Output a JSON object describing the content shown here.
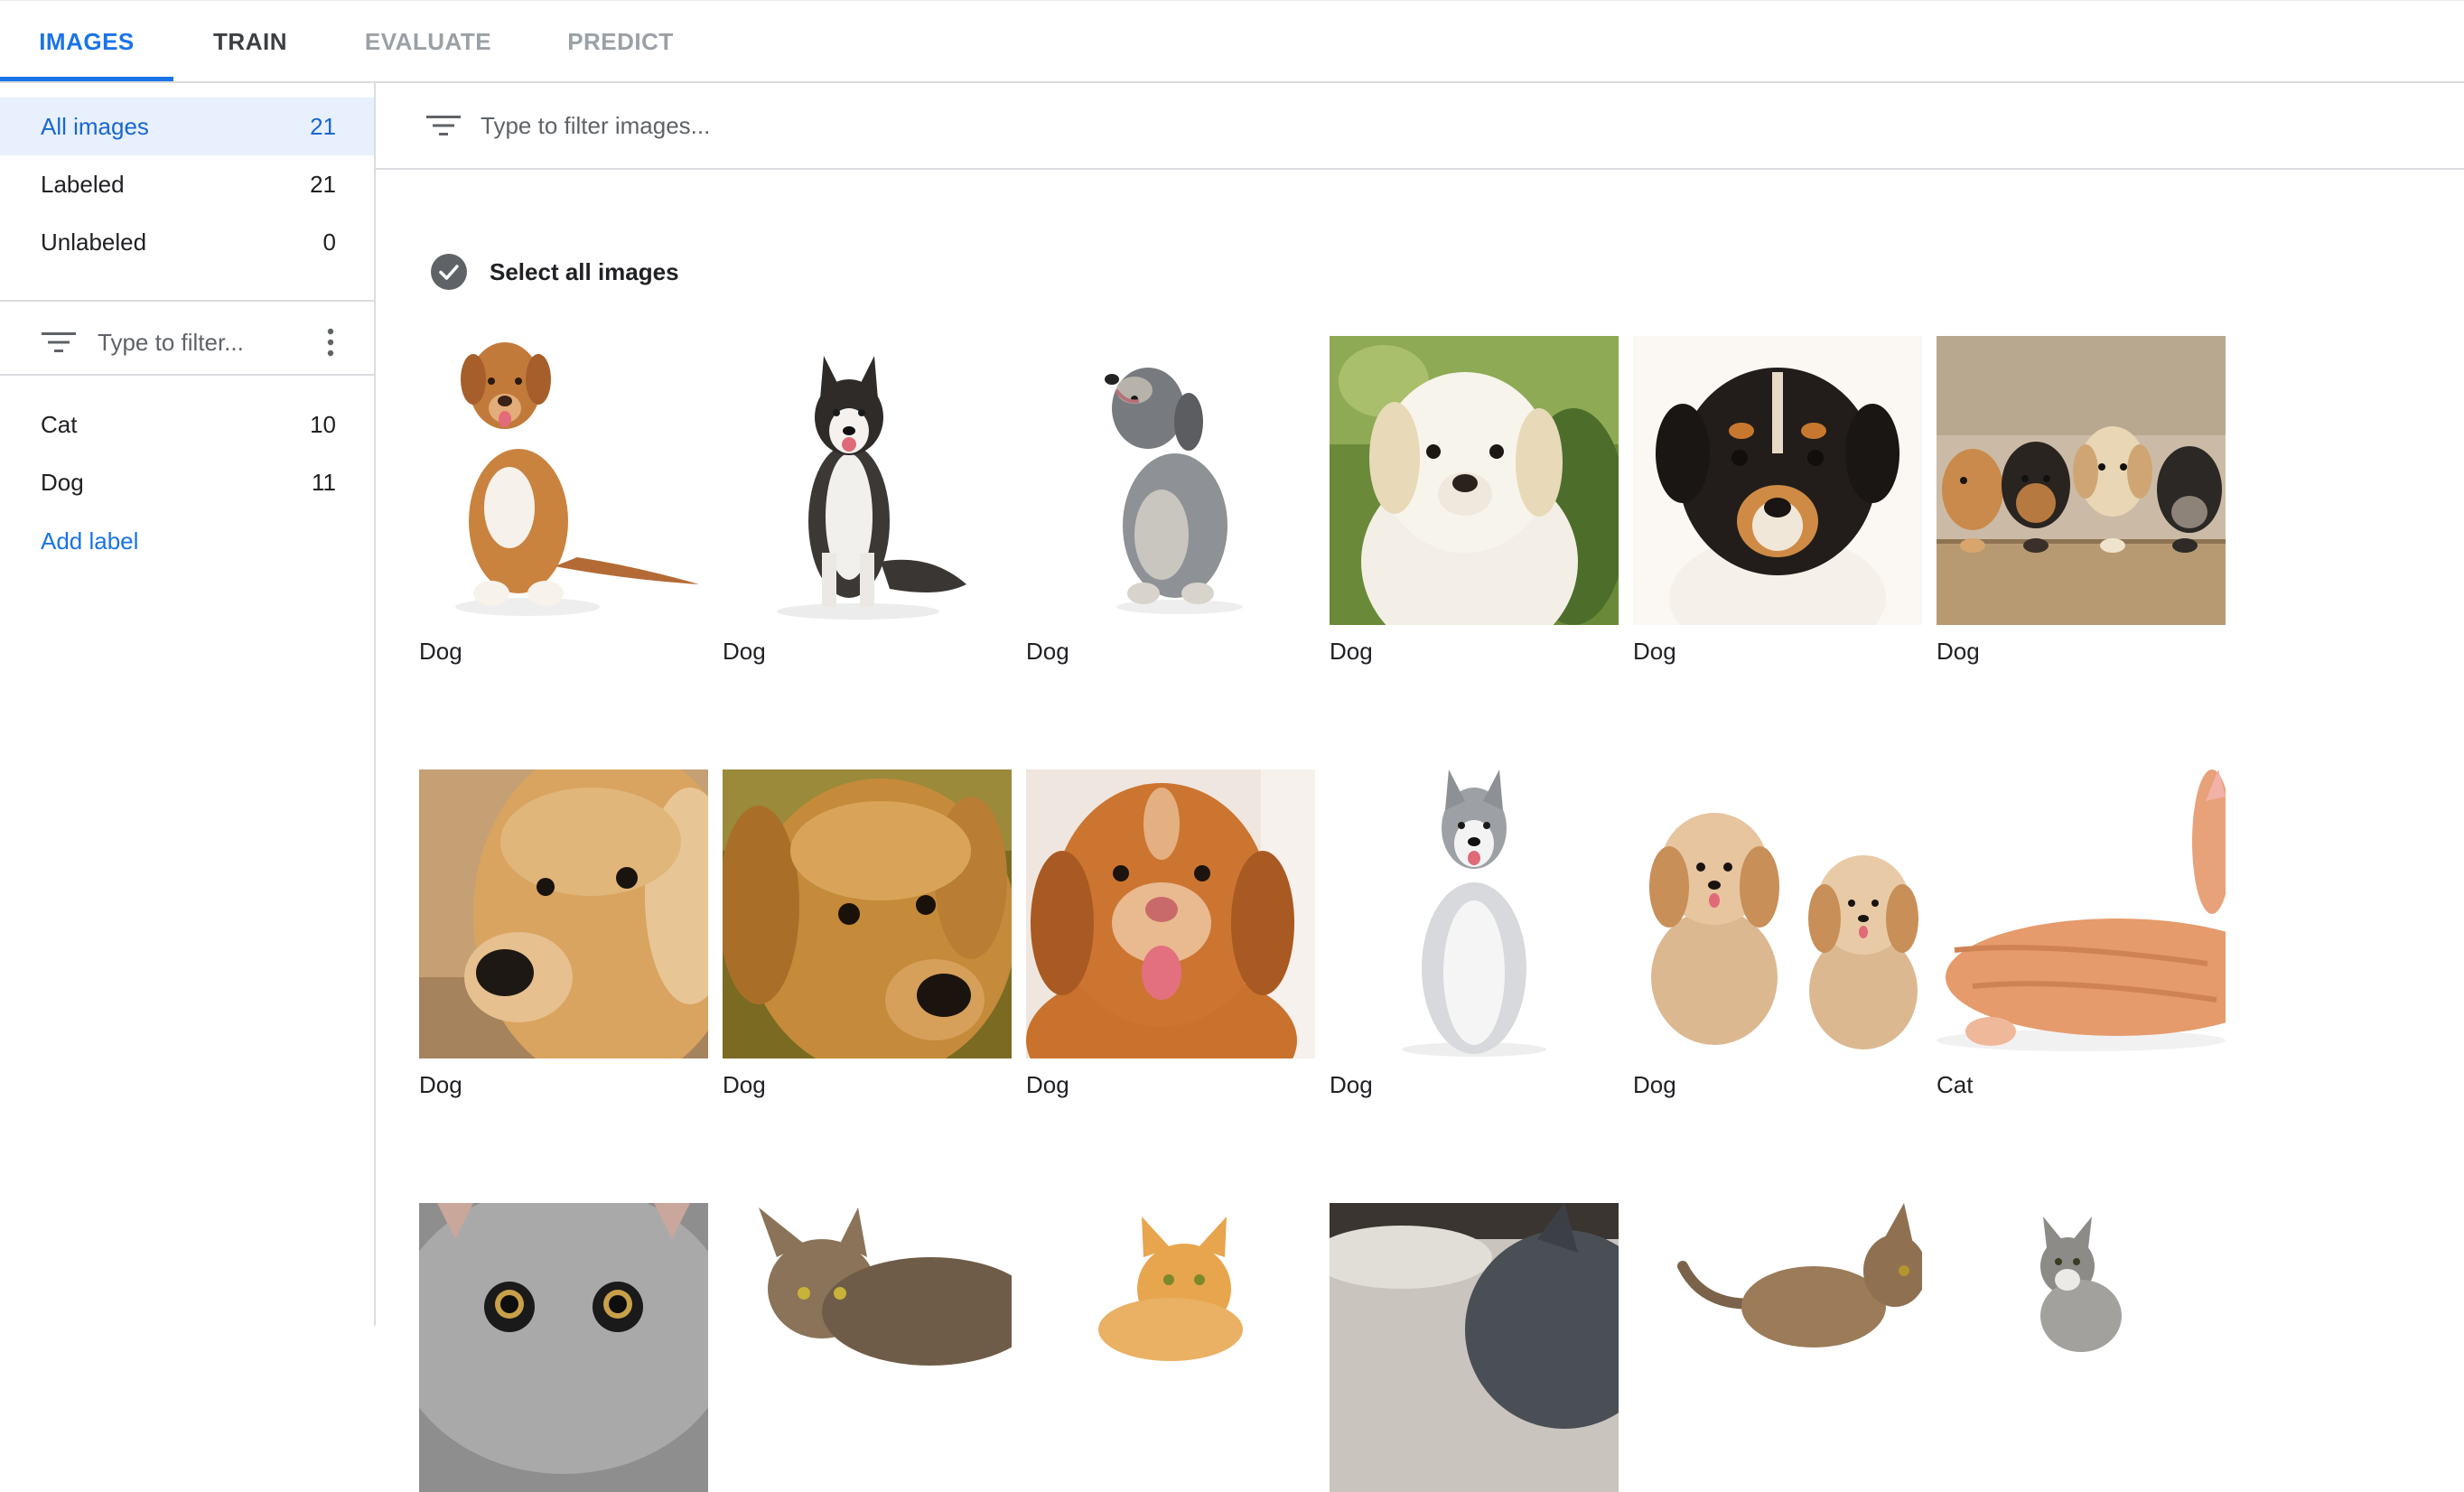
{
  "tabs": [
    {
      "label": "IMAGES",
      "state": "active"
    },
    {
      "label": "TRAIN",
      "state": "enabled"
    },
    {
      "label": "EVALUATE",
      "state": "disabled"
    },
    {
      "label": "PREDICT",
      "state": "disabled"
    }
  ],
  "sidebar": {
    "filters": [
      {
        "label": "All images",
        "count": "21",
        "selected": true
      },
      {
        "label": "Labeled",
        "count": "21",
        "selected": false
      },
      {
        "label": "Unlabeled",
        "count": "0",
        "selected": false
      }
    ],
    "label_filter_placeholder": "Type to filter...",
    "labels": [
      {
        "label": "Cat",
        "count": "10"
      },
      {
        "label": "Dog",
        "count": "11"
      }
    ],
    "add_label": "Add label"
  },
  "main": {
    "filter_placeholder": "Type to filter images...",
    "select_all_label": "Select all images",
    "images": [
      {
        "label": "Dog",
        "subject": "brown-dog-sitting"
      },
      {
        "label": "Dog",
        "subject": "husky-sitting"
      },
      {
        "label": "Dog",
        "subject": "grey-terrier-howling"
      },
      {
        "label": "Dog",
        "subject": "white-lab-puppy"
      },
      {
        "label": "Dog",
        "subject": "black-tan-puppy"
      },
      {
        "label": "Dog",
        "subject": "puppies-in-box"
      },
      {
        "label": "Dog",
        "subject": "golden-retriever-face"
      },
      {
        "label": "Dog",
        "subject": "golden-puppy-face"
      },
      {
        "label": "Dog",
        "subject": "toller-smiling"
      },
      {
        "label": "Dog",
        "subject": "white-husky-sitting"
      },
      {
        "label": "Dog",
        "subject": "two-fluffy-puppies"
      },
      {
        "label": "Cat",
        "subject": "orange-cat-lying"
      },
      {
        "label": "",
        "subject": "grey-cat-closeup"
      },
      {
        "label": "",
        "subject": "tabby-cat-lying"
      },
      {
        "label": "",
        "subject": "orange-kitten"
      },
      {
        "label": "",
        "subject": "dark-cat-sleeping"
      },
      {
        "label": "",
        "subject": "tabby-cat-walking"
      },
      {
        "label": "",
        "subject": "grey-kitten"
      }
    ]
  },
  "colors": {
    "accent": "#1a73e8",
    "selected_bg": "#e8f0fe",
    "divider": "#dadce0",
    "disabled_tab": "#9aa0a6"
  },
  "icons": {
    "filter": "filter-list-icon",
    "more": "more-vert-icon",
    "check": "check-circle-icon"
  }
}
